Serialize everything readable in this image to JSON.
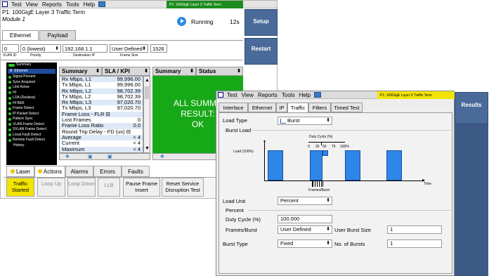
{
  "w1": {
    "menu": [
      "Test",
      "View",
      "Reports",
      "Tools",
      "Help"
    ],
    "green_title": "P1: 100GigE Layer 3 Traffic Term",
    "test_name": "P1: 100GigE Layer 3 Traffic Term",
    "module": "Module 1",
    "status": "Running",
    "elapsed": "12s",
    "setup_label": "Setup",
    "restart_label": "Restart",
    "tabs": [
      "Ethernet",
      "Payload"
    ],
    "fields": {
      "vlan_id": "0",
      "vlan_id_label": "VLAN ID",
      "priority": "0 (lowest)",
      "priority_label": "Priority",
      "dest_ip": "192.168.1.1",
      "dest_ip_label": "Destination IP",
      "frame_size_mode": "User Defined",
      "frame_size_label": "Frame Size",
      "frame_size": "1526"
    },
    "tree": [
      "Summary",
      "Ethernet",
      "Signal Present",
      "Sync Acquired",
      "Link Active",
      "HI",
      "LOA (Deskew)",
      "HI BER",
      "Frame Detect",
      "IP Packet Detect",
      "Pattern Sync",
      "VLAN Frame Detect",
      "SVLAN Frame Detect",
      "Local Fault Detect",
      "Remote Fault Detect",
      "History"
    ],
    "table_headers": [
      "Summary",
      "SLA / KPI",
      "Summary",
      "Status"
    ],
    "rows": [
      {
        "k": "Rx Mbps, L1",
        "v": "99,996.00"
      },
      {
        "k": "Tx Mbps, L1",
        "v": "99,996.00"
      },
      {
        "k": "Rx Mbps, L2",
        "v": "98,702.39"
      },
      {
        "k": "Tx Mbps, L2",
        "v": "98,702.39"
      },
      {
        "k": "Rx Mbps, L3",
        "v": "97,020.70"
      },
      {
        "k": "Tx Mbps, L3",
        "v": "97,020.70"
      },
      {
        "k": "Frame Loss - FLR ⊟",
        "v": ""
      },
      {
        "k": "Lost Frames",
        "v": "0"
      },
      {
        "k": "Frame Loss Ratio",
        "v": "0.0"
      },
      {
        "k": "Round Trip Delay - FD (us) ⊟",
        "v": ""
      },
      {
        "k": "Average",
        "v": "< 4"
      },
      {
        "k": "Current",
        "v": "< 4"
      },
      {
        "k": "Maximum",
        "v": "< 4"
      }
    ],
    "status_lines": [
      "ALL SUMMA",
      "RESULT:",
      "OK"
    ],
    "bottom_tabs": [
      "Laser",
      "Actions",
      "Alarms",
      "Errors",
      "Faults"
    ],
    "actions": [
      "Traffic Started",
      "Loop Up",
      "Loop Down",
      "LLB",
      "Pause Frame Insert",
      "Reset Service Disruption Test"
    ]
  },
  "w2": {
    "menu": [
      "Test",
      "View",
      "Reports",
      "Tools",
      "Help"
    ],
    "green_title": "P1: 100GigE Layer 3 Traffic Term",
    "results_label": "Results",
    "tabs": [
      "Interface",
      "Ethernet",
      "IP",
      "Traffic",
      "Filters",
      "Timed Test"
    ],
    "load_type_label": "Load Type",
    "load_type": "Burst",
    "burst_load_label": "Burst Load",
    "diagram": {
      "duty_cycle": "Duty Cycle (%)",
      "ticks": [
        "0",
        "25",
        "50",
        "75",
        "100%"
      ],
      "load_label": "Load (100%)",
      "time_label": "Time",
      "frames_label": "Frames/Burst"
    },
    "load_unit_label": "Load Unit",
    "load_unit": "Percent",
    "percent_label": "Percent",
    "duty_cycle_label": "Duty Cycle (%)",
    "duty_cycle": "100.000",
    "frames_burst_label": "Frames/Burst",
    "frames_burst": "User Defined",
    "user_burst_size_label": "User Burst Size",
    "user_burst_size": "1",
    "burst_type_label": "Burst Type",
    "burst_type": "Fixed",
    "num_bursts_label": "No. of Bursts",
    "num_bursts": "1"
  }
}
